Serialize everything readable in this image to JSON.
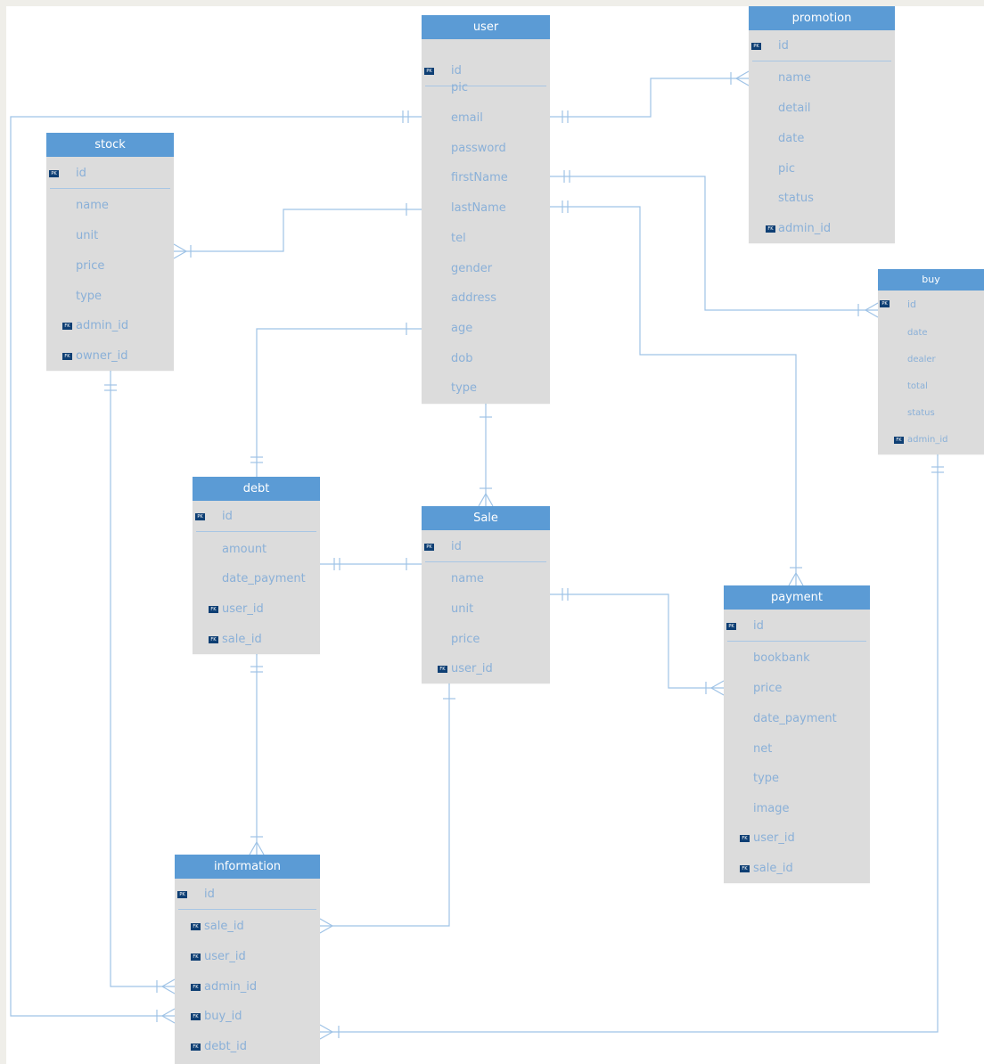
{
  "colors": {
    "header": "#5b9bd5",
    "body": "#dcdcdc",
    "text": "#8ab0d8",
    "line": "#9fc3e6",
    "key_badge": "#0e3f74"
  },
  "key_badges": {
    "pk": "PK",
    "fk": "FK"
  },
  "entities": {
    "user": {
      "title": "user",
      "pk": "id",
      "fields": [
        "pic",
        "email",
        "password",
        "firstName",
        "lastName",
        "tel",
        "gender",
        "address",
        "age",
        "dob",
        "type"
      ]
    },
    "promotion": {
      "title": "promotion",
      "pk": "id",
      "fields": [
        "name",
        "detail",
        "date",
        "pic",
        "status"
      ],
      "fks": [
        "admin_id"
      ]
    },
    "stock": {
      "title": "stock",
      "pk": "id",
      "fields": [
        "name",
        "unit",
        "price",
        "type"
      ],
      "fks": [
        "admin_id",
        "owner_id"
      ]
    },
    "buy": {
      "title": "buy",
      "pk": "id",
      "fields": [
        "date",
        "dealer",
        "total",
        "status"
      ],
      "fks": [
        "admin_id"
      ]
    },
    "debt": {
      "title": "debt",
      "pk": "id",
      "fields": [
        "amount",
        "date_payment"
      ],
      "fks": [
        "user_id",
        "sale_id"
      ]
    },
    "sale": {
      "title": "Sale",
      "pk": "id",
      "fields": [
        "name",
        "unit",
        "price"
      ],
      "fks": [
        "user_id"
      ]
    },
    "payment": {
      "title": "payment",
      "pk": "id",
      "fields": [
        "bookbank",
        "price",
        "date_payment",
        "net",
        "type",
        "image"
      ],
      "fks": [
        "user_id",
        "sale_id"
      ]
    },
    "information": {
      "title": "information",
      "pk": "id",
      "fields": [],
      "fks": [
        "sale_id",
        "user_id",
        "admin_id",
        "buy_id",
        "debt_id"
      ]
    }
  }
}
